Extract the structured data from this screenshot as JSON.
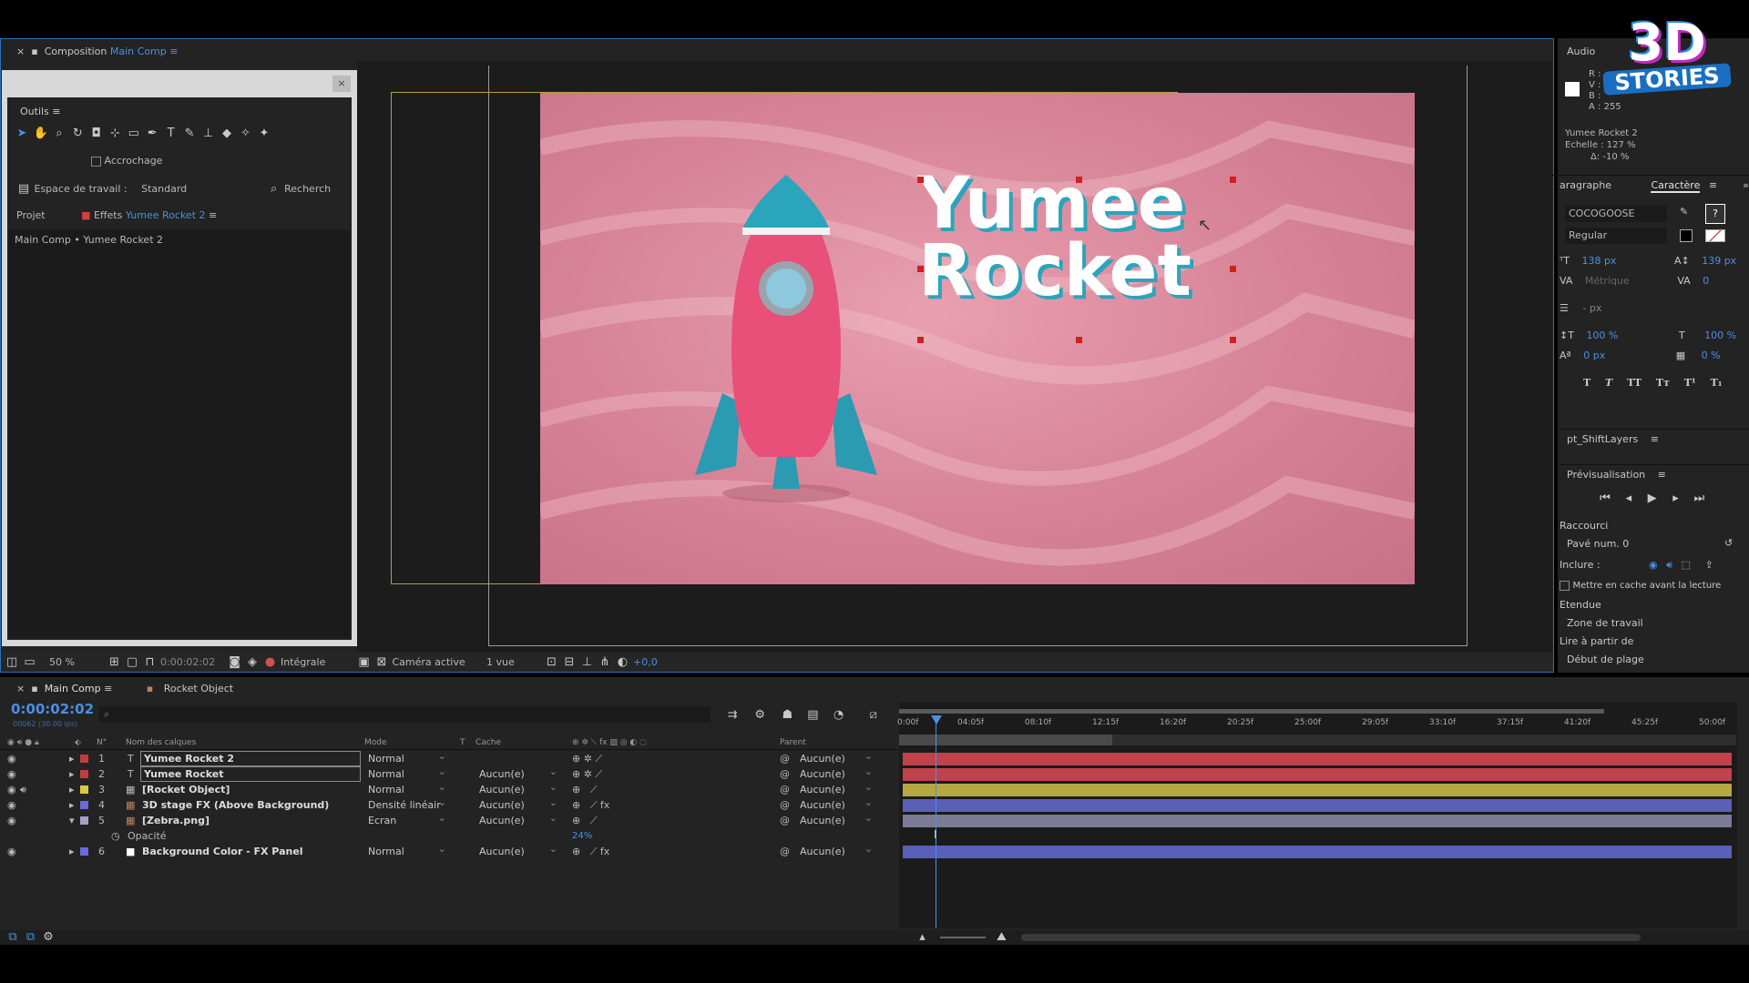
{
  "comp_viewer": {
    "tab_label": "Composition",
    "comp_name": "Main Comp",
    "zoom": "50 %",
    "timecode": "0:00:02:02",
    "resolution": "Intégrale",
    "camera": "Caméra active",
    "views": "1 vue",
    "exposure": "+0,0",
    "title_line1": "Yumee",
    "title_line2": "Rocket"
  },
  "tools": {
    "title": "Outils",
    "snap_label": "Accrochage",
    "workspace_label": "Espace de travail :",
    "workspace_value": "Standard",
    "search_label": "Recherch"
  },
  "project": {
    "tab_projet": "Projet",
    "tab_effects": "Effets",
    "effects_layer": "Yumee Rocket 2",
    "breadcrumb": "Main Comp • Yumee Rocket 2"
  },
  "info": {
    "tab": "Audio",
    "r": "R :",
    "v": "V :",
    "b": "B :",
    "a": "A :",
    "a_val": "255",
    "layer": "Yumee Rocket 2",
    "scale": "Echelle : 127 %",
    "delta": "Δ: -10 %"
  },
  "logo": {
    "line1": "3D",
    "line2": "STORIES"
  },
  "character": {
    "tab_paragraph": "aragraphe",
    "tab_character": "Caractère",
    "font": "COCOGOOSE",
    "style": "Regular",
    "size": "138 px",
    "leading": "139 px",
    "kerning": "Métrique",
    "tracking": "0",
    "stroke": "- px",
    "vscale": "100 %",
    "hscale": "100 %",
    "baseline": "0 px",
    "tsume": "0 %",
    "style_buttons": [
      "T",
      "T",
      "TT",
      "Tт",
      "T¹",
      "T₁"
    ]
  },
  "shift_layers": {
    "title": "pt_ShiftLayers"
  },
  "preview": {
    "title": "Prévisualisation",
    "shortcut_label": "Raccourci",
    "shortcut_value": "Pavé num. 0",
    "include_label": "Inclure :",
    "cache_label": "Mettre en cache avant la lecture",
    "range_label": "Etendue",
    "range_value": "Zone de travail",
    "play_from_label": "Lire à partir de",
    "play_from_value": "Début de plage"
  },
  "timeline": {
    "tab_main": "Main Comp",
    "tab_rocket": "Rocket Object",
    "timecode": "0:00:02:02",
    "frame_info": "00062 (30.00 ips)",
    "col_num": "N°",
    "col_name": "Nom des calques",
    "col_mode": "Mode",
    "col_t": "T",
    "col_cache": "Cache",
    "col_parent": "Parent",
    "ruler": [
      "0:00f",
      "04:05f",
      "08:10f",
      "12:15f",
      "16:20f",
      "20:25f",
      "25:00f",
      "29:05f",
      "33:10f",
      "37:15f",
      "41:20f",
      "45:25f",
      "50:00f"
    ],
    "layers": [
      {
        "num": "1",
        "name": "Yumee Rocket 2",
        "mode": "Normal",
        "cache": "",
        "parent": "Aucun(e)",
        "color": "#c43c3c",
        "type": "T"
      },
      {
        "num": "2",
        "name": "Yumee Rocket",
        "mode": "Normal",
        "cache": "Aucun(e)",
        "parent": "Aucun(e)",
        "color": "#c43c3c",
        "type": "T"
      },
      {
        "num": "3",
        "name": "[Rocket Object]",
        "mode": "Normal",
        "cache": "Aucun(e)",
        "parent": "Aucun(e)",
        "color": "#e0c840",
        "type": "img"
      },
      {
        "num": "4",
        "name": "3D stage FX (Above Background)",
        "mode": "Densité linéair",
        "cache": "Aucun(e)",
        "parent": "Aucun(e)",
        "color": "#6a6ad8",
        "type": "img"
      },
      {
        "num": "5",
        "name": "[Zebra.png]",
        "mode": "Ecran",
        "cache": "Aucun(e)",
        "parent": "Aucun(e)",
        "color": "#a0a0c8",
        "type": "img"
      },
      {
        "num": "6",
        "name": "Background Color - FX Panel",
        "mode": "Normal",
        "cache": "Aucun(e)",
        "parent": "Aucun(e)",
        "color": "#6a6ad8",
        "type": "solid"
      }
    ],
    "opacity_label": "Opacité",
    "opacity_value": "24%",
    "bar_colors": [
      "#c0434b",
      "#c0434b",
      "#b5a843",
      "#5a5fb8",
      "#7b7b95",
      "#5a5fb8"
    ]
  }
}
